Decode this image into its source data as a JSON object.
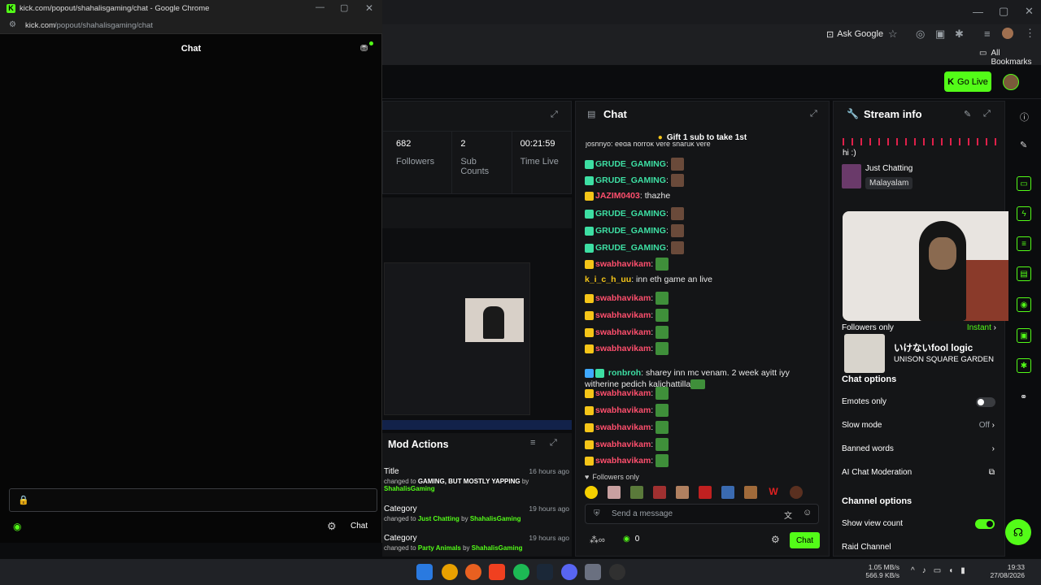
{
  "popout": {
    "window_title": "kick.com/popout/shahalisgaming/chat - Google Chrome",
    "url_host": "kick.com",
    "url_path": "/popout/shahalisgaming/chat",
    "header_title": "Chat",
    "chat_button": "Chat"
  },
  "browser": {
    "ask_google": "Ask Google",
    "all_bookmarks": "All Bookmarks"
  },
  "header": {
    "go_live": "Go Live"
  },
  "stats": [
    {
      "value": "682",
      "label": "Followers"
    },
    {
      "value": "2",
      "label": "Sub Counts"
    },
    {
      "value": "00:21:59",
      "label": "Time Live"
    }
  ],
  "mod": {
    "title": "Mod Actions",
    "actions": [
      {
        "type": "Title",
        "time": "16 hours ago",
        "prefix": "changed to ",
        "value": "GAMING, BUT MOSTLY YAPPING",
        "by": " by ",
        "user": "ShahalisGaming"
      },
      {
        "type": "Category",
        "time": "19 hours ago",
        "prefix": "changed to ",
        "value": "Just Chatting",
        "by": " by ",
        "user": "ShahalisGaming"
      },
      {
        "type": "Category",
        "time": "19 hours ago",
        "prefix": "changed to ",
        "value": "Party Animals",
        "by": " by ",
        "user": "ShahalisGaming"
      }
    ]
  },
  "chat": {
    "title": "Chat",
    "gift_banner": "Gift 1 sub to take 1st",
    "top_partial": "joshnyo: eeda horrok vere sharuk vere",
    "messages": [
      {
        "user": "GRUDE_GAMING",
        "text": ":",
        "color": "green",
        "emote": "face"
      },
      {
        "user": "GRUDE_GAMING",
        "text": ":",
        "color": "green",
        "emote": "face"
      },
      {
        "user": "JAZIM0403",
        "text": ": thazhe",
        "color": "pink",
        "emote": ""
      },
      {
        "user": "GRUDE_GAMING",
        "text": ":",
        "color": "green",
        "emote": "face"
      },
      {
        "user": "GRUDE_GAMING",
        "text": ":",
        "color": "green",
        "emote": "face"
      },
      {
        "user": "GRUDE_GAMING",
        "text": ":",
        "color": "green",
        "emote": "face"
      },
      {
        "user": "swabhavikam",
        "text": ":",
        "color": "pink",
        "emote": "frog"
      },
      {
        "user": "k_i_c_h_uu",
        "text": ": inn eth game an live",
        "color": "yel",
        "emote": ""
      },
      {
        "user": "swabhavikam",
        "text": ":",
        "color": "pink",
        "emote": "frog"
      },
      {
        "user": "swabhavikam",
        "text": ":",
        "color": "pink",
        "emote": "frog"
      },
      {
        "user": "swabhavikam",
        "text": ":",
        "color": "pink",
        "emote": "frog"
      },
      {
        "user": "swabhavikam",
        "text": ":",
        "color": "pink",
        "emote": "frog"
      }
    ],
    "long_msg_user": "ronbroh",
    "long_msg_line1": ": sharey inn mc venam. 2 week ayitt iyy",
    "long_msg_line2": "witherine pedich kalichattilla",
    "messages_after": [
      {
        "user": "swabhavikam",
        "text": ":",
        "color": "pink",
        "emote": "frog"
      },
      {
        "user": "swabhavikam",
        "text": ":",
        "color": "pink",
        "emote": "frog"
      },
      {
        "user": "swabhavikam",
        "text": ":",
        "color": "pink",
        "emote": "frog"
      },
      {
        "user": "swabhavikam",
        "text": ":",
        "color": "pink",
        "emote": "frog"
      },
      {
        "user": "swabhavikam",
        "text": ":",
        "color": "pink",
        "emote": "frog"
      }
    ],
    "followers_only": "Followers only",
    "input_placeholder": "Send a message",
    "points": "0",
    "send": "Chat"
  },
  "info": {
    "title": "Stream info",
    "stream_title": "hi :)",
    "category": "Just Chatting",
    "tag": "Malayalam",
    "followers_only_label": "Followers only",
    "followers_only_value": "Instant",
    "chat_options_title": "Chat options",
    "emotes_only": "Emotes only",
    "slow_mode": "Slow mode",
    "slow_mode_value": "Off",
    "banned_words": "Banned words",
    "ai_moderation": "AI Chat Moderation",
    "channel_options_title": "Channel options",
    "show_view_count": "Show view count",
    "raid_channel": "Raid Channel"
  },
  "now_playing": {
    "song": "いけないfool logic",
    "artist": "UNISON SQUARE GARDEN"
  },
  "tray": {
    "net_up": "1.05 MB/s",
    "net_down": "566.9 KB/s",
    "time": "19:33",
    "date": "27/08/2026"
  },
  "colors": {
    "accent": "#53fc18",
    "panel": "#141517"
  }
}
